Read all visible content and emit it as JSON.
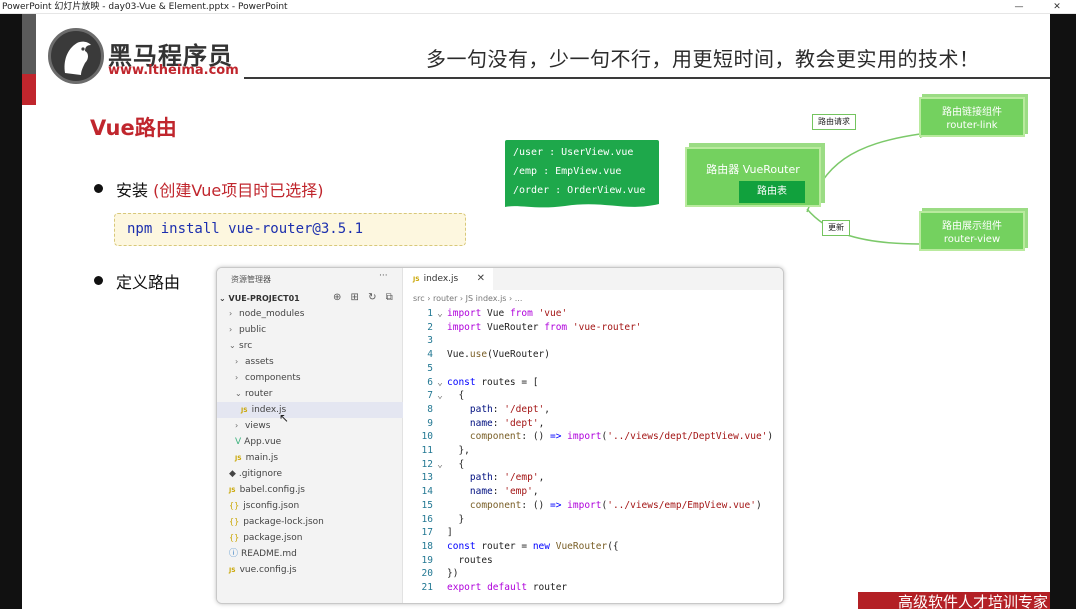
{
  "window": {
    "title": "PowerPoint 幻灯片放映 - day03-Vue & Element.pptx - PowerPoint",
    "minimize": "—",
    "close": "✕"
  },
  "header": {
    "logo_cn": "黑马程序员",
    "logo_url": "www.itheima.com",
    "slogan": "多一句没有，少一句不行，用更短时间，教会更实用的技术！"
  },
  "slide": {
    "title": "Vue路由",
    "bullets": [
      {
        "text": "安装",
        "note": "(创建Vue项目时已选择)"
      },
      {
        "text": "定义路由"
      }
    ],
    "npm_command": "npm install vue-router@3.5.1"
  },
  "diagram": {
    "routes": [
      "/user : UserView.vue",
      "/emp : EmpView.vue",
      "/order : OrderView.vue"
    ],
    "router_title": "路由器 VueRouter",
    "route_table": "路由表",
    "link_box": {
      "title": "路由链接组件",
      "name": "router-link"
    },
    "view_box": {
      "title": "路由展示组件",
      "name": "router-view"
    },
    "request_label": "路由请求",
    "update_label": "更新"
  },
  "editor": {
    "explorer_title": "资源管理器",
    "explorer_dots": "···",
    "project": "VUE-PROJECT01",
    "tools": "⊕ ⊞ ↻ ⧉",
    "tree": [
      {
        "label": "node_modules",
        "icon": "›"
      },
      {
        "label": "public",
        "icon": "›"
      },
      {
        "label": "src",
        "icon": "⌄"
      },
      {
        "label": "assets",
        "icon": "›"
      },
      {
        "label": "components",
        "icon": "›"
      },
      {
        "label": "router",
        "icon": "⌄"
      },
      {
        "label": "index.js",
        "icon": "JS"
      },
      {
        "label": "views",
        "icon": "›"
      },
      {
        "label": "App.vue",
        "icon": "V"
      },
      {
        "label": "main.js",
        "icon": "JS"
      },
      {
        "label": ".gitignore",
        "icon": "◆"
      },
      {
        "label": "babel.config.js",
        "icon": "JS"
      },
      {
        "label": "jsconfig.json",
        "icon": "{}"
      },
      {
        "label": "package-lock.json",
        "icon": "{}"
      },
      {
        "label": "package.json",
        "icon": "{}"
      },
      {
        "label": "README.md",
        "icon": "ⓘ"
      },
      {
        "label": "vue.config.js",
        "icon": "JS"
      }
    ],
    "tab": {
      "icon": "JS",
      "label": "index.js",
      "close": "✕"
    },
    "breadcrumb": "src › router › JS index.js › ..."
  },
  "footer": {
    "text": "高级软件人才培训专家"
  }
}
